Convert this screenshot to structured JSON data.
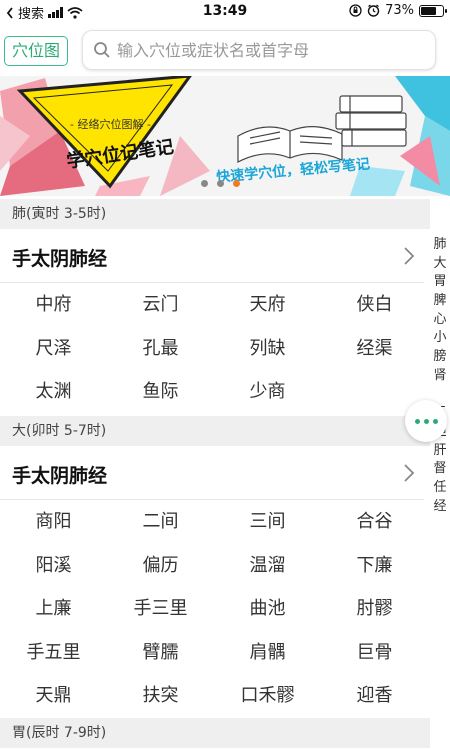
{
  "status_bar": {
    "carrier": "搜索",
    "time": "13:49",
    "battery": "73%",
    "battery_level": 0.73
  },
  "header": {
    "map_button": "穴位图",
    "search_placeholder": "输入穴位或症状名或首字母"
  },
  "banner": {
    "subtitle": "- 经络穴位图解 -",
    "title": "学穴位记笔记",
    "slogan": "快速学穴位，轻松写笔记",
    "dot_count": 3,
    "active_dot": 2
  },
  "sections": [
    {
      "header": "肺(寅时 3-5时)",
      "meridian": "手太阴肺经",
      "points": [
        "中府",
        "云门",
        "天府",
        "侠白",
        "尺泽",
        "孔最",
        "列缺",
        "经渠",
        "太渊",
        "鱼际",
        "少商"
      ]
    },
    {
      "header": "大(卯时 5-7时)",
      "meridian": "手太阴肺经",
      "points": [
        "商阳",
        "二间",
        "三间",
        "合谷",
        "阳溪",
        "偏历",
        "温溜",
        "下廉",
        "上廉",
        "手三里",
        "曲池",
        "肘髎",
        "手五里",
        "臂臑",
        "肩髃",
        "巨骨",
        "天鼎",
        "扶突",
        "口禾髎",
        "迎香"
      ]
    },
    {
      "header": "胃(辰时 7-9时)"
    }
  ],
  "index_items": [
    "肺",
    "大",
    "胃",
    "脾",
    "心",
    "小",
    "膀",
    "肾",
    "",
    "三",
    "胆",
    "肝",
    "督",
    "任",
    "经"
  ],
  "colors": {
    "accent": "#2aaa75",
    "active_dot": "#f07c22",
    "section_bg": "#efefef"
  },
  "icons": {
    "search": "search-icon",
    "chevron": "chevron-right-icon",
    "more": "more-dots-icon"
  }
}
